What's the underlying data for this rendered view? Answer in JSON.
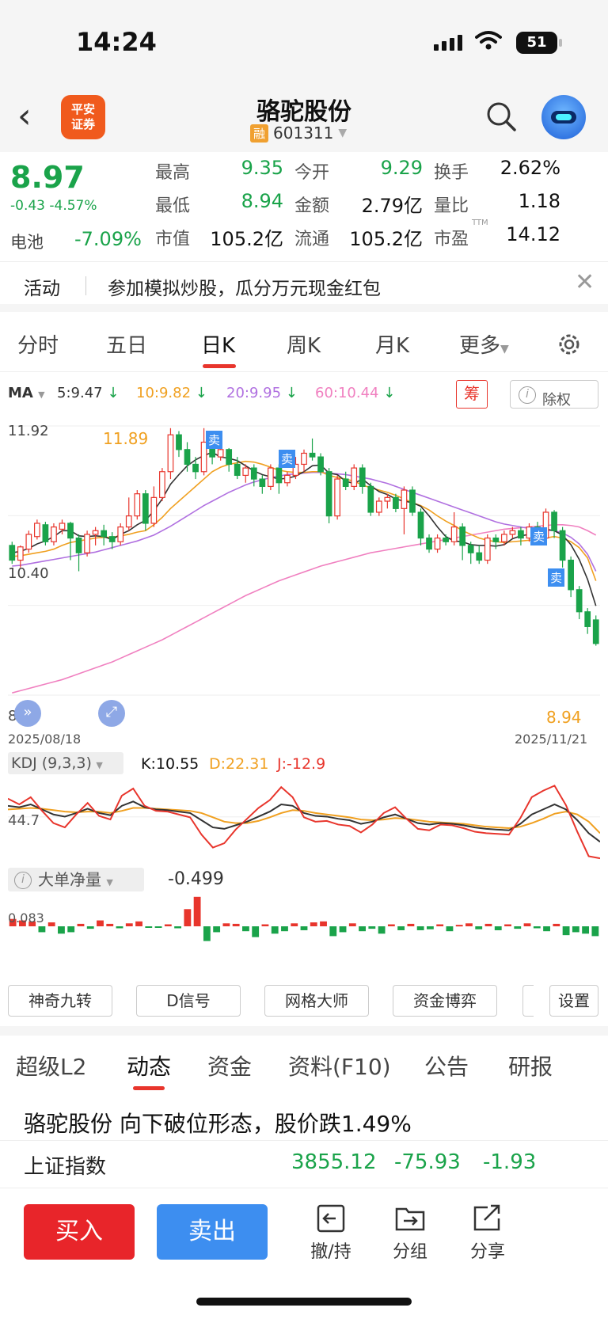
{
  "status": {
    "time": "14:24",
    "battery": "51"
  },
  "header": {
    "logo_top": "平安",
    "logo_bottom": "证券",
    "name": "骆驼股份",
    "tag": "融",
    "code": "601311"
  },
  "quote": {
    "price": "8.97",
    "change": "-0.43 -4.57%",
    "sector": "电池",
    "sector_change": "-7.09%",
    "fields": [
      {
        "label": "最高",
        "value": "9.35"
      },
      {
        "label": "今开",
        "value": "9.29"
      },
      {
        "label": "换手",
        "value": "2.62%"
      },
      {
        "label": "最低",
        "value": "8.94"
      },
      {
        "label": "金额",
        "value": "2.79亿"
      },
      {
        "label": "量比",
        "value": "1.18"
      },
      {
        "label": "市值",
        "value": "105.2亿"
      },
      {
        "label": "流通",
        "value": "105.2亿"
      },
      {
        "label": "市盈",
        "value": "14.12",
        "sup": "TTM"
      }
    ]
  },
  "banner": {
    "tag": "活动",
    "text": "参加模拟炒股，瓜分万元现金红包"
  },
  "chart_tabs": [
    "分时",
    "五日",
    "日K",
    "周K",
    "月K",
    "更多"
  ],
  "active_chart_tab": "日K",
  "ma": {
    "label": "MA",
    "items": [
      {
        "text": "5:9.47",
        "color": "#333333"
      },
      {
        "text": "10:9.82",
        "color": "#f0a020"
      },
      {
        "text": "20:9.95",
        "color": "#b070e0"
      },
      {
        "text": "60:10.44",
        "color": "#f080c0"
      }
    ],
    "chip_btn": "筹",
    "fq_btn": "除权"
  },
  "chart_data": {
    "type": "candlestick",
    "y_max_label": "11.92",
    "y_mid_label": "10.40",
    "y_min_label": "8.27",
    "high_mark": "11.89",
    "low_mark": "8.94",
    "x_start": "2025/08/18",
    "x_end": "2025/11/21",
    "sell_marker": "卖",
    "candles": [
      [
        10.3,
        10.1,
        10.35,
        10.05
      ],
      [
        10.1,
        10.28,
        10.3,
        10.0
      ],
      [
        10.25,
        10.45,
        10.5,
        10.2
      ],
      [
        10.42,
        10.6,
        10.65,
        10.38
      ],
      [
        10.58,
        10.35,
        10.62,
        10.3
      ],
      [
        10.35,
        10.55,
        10.6,
        10.3
      ],
      [
        10.52,
        10.6,
        10.65,
        10.45
      ],
      [
        10.6,
        10.4,
        10.62,
        10.1
      ],
      [
        10.4,
        10.2,
        10.45,
        9.95
      ],
      [
        10.2,
        10.45,
        10.5,
        10.15
      ],
      [
        10.45,
        10.5,
        10.55,
        10.3
      ],
      [
        10.5,
        10.42,
        10.58,
        10.3
      ],
      [
        10.42,
        10.35,
        10.48,
        10.25
      ],
      [
        10.35,
        10.55,
        10.6,
        10.3
      ],
      [
        10.55,
        10.7,
        10.95,
        10.5
      ],
      [
        10.7,
        11.0,
        11.05,
        10.65
      ],
      [
        11.0,
        10.6,
        11.05,
        10.5
      ],
      [
        10.6,
        10.95,
        11.1,
        10.55
      ],
      [
        10.95,
        11.3,
        11.35,
        10.9
      ],
      [
        11.3,
        11.8,
        11.89,
        11.2
      ],
      [
        11.8,
        11.6,
        11.85,
        11.5
      ],
      [
        11.6,
        11.4,
        11.7,
        11.3
      ],
      [
        11.4,
        11.3,
        11.5,
        11.2
      ],
      [
        11.3,
        11.7,
        11.89,
        11.25
      ],
      [
        11.7,
        11.5,
        11.75,
        11.4
      ],
      [
        11.5,
        11.6,
        11.65,
        11.45
      ],
      [
        11.6,
        11.4,
        11.62,
        11.3
      ],
      [
        11.4,
        11.25,
        11.5,
        11.2
      ],
      [
        11.25,
        11.35,
        11.4,
        11.15
      ],
      [
        11.35,
        11.2,
        11.4,
        11.1
      ],
      [
        11.2,
        11.1,
        11.25,
        11.0
      ],
      [
        11.1,
        11.35,
        11.4,
        11.05
      ],
      [
        11.35,
        11.15,
        11.4,
        11.0
      ],
      [
        11.15,
        11.25,
        11.3,
        11.1
      ],
      [
        11.25,
        11.4,
        11.5,
        11.2
      ],
      [
        11.4,
        11.55,
        11.6,
        11.3
      ],
      [
        11.55,
        11.5,
        11.75,
        11.45
      ],
      [
        11.5,
        11.3,
        11.55,
        11.25
      ],
      [
        11.3,
        10.7,
        11.35,
        10.6
      ],
      [
        10.7,
        11.2,
        11.25,
        10.65
      ],
      [
        11.2,
        11.1,
        11.3,
        11.05
      ],
      [
        11.1,
        11.35,
        11.4,
        11.05
      ],
      [
        11.35,
        11.1,
        11.4,
        11.0
      ],
      [
        11.1,
        10.75,
        11.15,
        10.7
      ],
      [
        10.75,
        10.9,
        10.95,
        10.7
      ],
      [
        10.9,
        10.95,
        11.0,
        10.8
      ],
      [
        10.95,
        10.8,
        11.0,
        10.75
      ],
      [
        10.8,
        11.05,
        11.1,
        10.45
      ],
      [
        11.05,
        10.75,
        11.1,
        10.7
      ],
      [
        10.75,
        10.4,
        10.8,
        10.3
      ],
      [
        10.4,
        10.25,
        10.45,
        10.2
      ],
      [
        10.25,
        10.4,
        10.45,
        10.2
      ],
      [
        10.4,
        10.35,
        10.45,
        10.3
      ],
      [
        10.35,
        10.55,
        10.75,
        10.3
      ],
      [
        10.55,
        10.3,
        10.6,
        10.1
      ],
      [
        10.3,
        10.2,
        10.35,
        10.05
      ],
      [
        10.2,
        10.1,
        10.3,
        10.05
      ],
      [
        10.1,
        10.4,
        10.45,
        10.05
      ],
      [
        10.4,
        10.35,
        10.45,
        10.25
      ],
      [
        10.35,
        10.45,
        10.5,
        10.3
      ],
      [
        10.45,
        10.5,
        10.55,
        10.4
      ],
      [
        10.5,
        10.4,
        10.55,
        10.3
      ],
      [
        10.4,
        10.55,
        10.6,
        10.35
      ],
      [
        10.55,
        10.4,
        10.62,
        10.35
      ],
      [
        10.4,
        10.75,
        10.8,
        10.35
      ],
      [
        10.75,
        10.5,
        10.78,
        10.4
      ],
      [
        10.5,
        10.1,
        10.55,
        10.0
      ],
      [
        10.1,
        9.7,
        10.15,
        9.6
      ],
      [
        9.7,
        9.4,
        9.75,
        9.3
      ],
      [
        9.4,
        9.2,
        9.45,
        9.1
      ],
      [
        9.29,
        8.97,
        9.35,
        8.94
      ]
    ],
    "ma5": [
      10.2,
      10.22,
      10.26,
      10.32,
      10.36,
      10.42,
      10.5,
      10.5,
      10.43,
      10.42,
      10.43,
      10.42,
      10.38,
      10.45,
      10.5,
      10.58,
      10.64,
      10.77,
      10.93,
      11.13,
      11.26,
      11.38,
      11.46,
      11.52,
      11.56,
      11.5,
      11.48,
      11.45,
      11.38,
      11.31,
      11.26,
      11.23,
      11.2,
      11.21,
      11.24,
      11.3,
      11.38,
      11.39,
      11.28,
      11.26,
      11.17,
      11.14,
      11.2,
      11.11,
      11.03,
      10.99,
      10.93,
      10.9,
      10.88,
      10.83,
      10.7,
      10.55,
      10.42,
      10.36,
      10.35,
      10.31,
      10.3,
      10.3,
      10.29,
      10.31,
      10.39,
      10.43,
      10.45,
      10.47,
      10.52,
      10.5,
      10.44,
      10.31,
      10.11,
      9.84,
      9.48
    ],
    "ma10": [
      10.15,
      10.16,
      10.18,
      10.2,
      10.22,
      10.25,
      10.3,
      10.34,
      10.36,
      10.38,
      10.4,
      10.41,
      10.41,
      10.43,
      10.45,
      10.48,
      10.5,
      10.58,
      10.68,
      10.8,
      10.9,
      11.0,
      11.1,
      11.2,
      11.3,
      11.36,
      11.4,
      11.42,
      11.44,
      11.43,
      11.4,
      11.36,
      11.32,
      11.3,
      11.29,
      11.29,
      11.3,
      11.3,
      11.25,
      11.22,
      11.2,
      11.17,
      11.12,
      11.08,
      11.05,
      11.02,
      10.98,
      10.93,
      10.88,
      10.84,
      10.78,
      10.7,
      10.63,
      10.57,
      10.5,
      10.45,
      10.4,
      10.37,
      10.35,
      10.34,
      10.35,
      10.36,
      10.37,
      10.38,
      10.4,
      10.42,
      10.4,
      10.35,
      10.27,
      10.13,
      9.82
    ],
    "ma20": [
      10.02,
      10.03,
      10.05,
      10.07,
      10.09,
      10.11,
      10.13,
      10.15,
      10.17,
      10.19,
      10.21,
      10.24,
      10.27,
      10.3,
      10.33,
      10.36,
      10.4,
      10.44,
      10.5,
      10.56,
      10.63,
      10.7,
      10.77,
      10.84,
      10.9,
      10.96,
      11.02,
      11.07,
      11.12,
      11.16,
      11.19,
      11.22,
      11.24,
      11.26,
      11.27,
      11.28,
      11.29,
      11.29,
      11.28,
      11.27,
      11.26,
      11.24,
      11.22,
      11.2,
      11.17,
      11.14,
      11.1,
      11.06,
      11.02,
      10.98,
      10.94,
      10.9,
      10.86,
      10.82,
      10.78,
      10.74,
      10.7,
      10.66,
      10.62,
      10.59,
      10.57,
      10.55,
      10.53,
      10.52,
      10.51,
      10.5,
      10.47,
      10.41,
      10.32,
      10.18,
      9.95
    ],
    "ma60": [
      8.3,
      8.33,
      8.36,
      8.39,
      8.42,
      8.45,
      8.48,
      8.52,
      8.56,
      8.6,
      8.64,
      8.68,
      8.72,
      8.77,
      8.82,
      8.87,
      8.92,
      8.97,
      9.02,
      9.08,
      9.14,
      9.2,
      9.26,
      9.32,
      9.38,
      9.44,
      9.5,
      9.56,
      9.62,
      9.67,
      9.72,
      9.77,
      9.82,
      9.86,
      9.9,
      9.94,
      9.98,
      10.02,
      10.05,
      10.08,
      10.11,
      10.14,
      10.17,
      10.2,
      10.22,
      10.24,
      10.26,
      10.28,
      10.3,
      10.32,
      10.34,
      10.36,
      10.38,
      10.4,
      10.42,
      10.44,
      10.46,
      10.48,
      10.5,
      10.52,
      10.53,
      10.54,
      10.55,
      10.56,
      10.57,
      10.58,
      10.58,
      10.57,
      10.55,
      10.5,
      10.44
    ]
  },
  "kdj": {
    "label": "KDJ (9,3,3)",
    "k": "K:10.55",
    "d": "D:22.31",
    "j": "J:-12.9",
    "mid": "44.7",
    "k_line": [
      60,
      58,
      62,
      55,
      48,
      45,
      50,
      56,
      50,
      47,
      60,
      66,
      58,
      55,
      54,
      52,
      50,
      40,
      30,
      28,
      33,
      38,
      45,
      52,
      62,
      60,
      50,
      46,
      45,
      42,
      40,
      35,
      38,
      44,
      48,
      42,
      36,
      34,
      36,
      35,
      33,
      30,
      28,
      27,
      26,
      35,
      48,
      55,
      62,
      55,
      40,
      22,
      10
    ],
    "d_line": [
      55,
      56,
      57,
      56,
      54,
      52,
      51,
      52,
      52,
      50,
      53,
      57,
      57,
      56,
      55,
      54,
      53,
      50,
      44,
      38,
      36,
      36,
      39,
      44,
      50,
      54,
      53,
      50,
      48,
      46,
      44,
      41,
      40,
      41,
      43,
      42,
      40,
      38,
      37,
      36,
      35,
      33,
      31,
      30,
      29,
      31,
      36,
      42,
      49,
      52,
      48,
      38,
      22
    ],
    "j_line": [
      70,
      62,
      72,
      53,
      36,
      30,
      48,
      64,
      46,
      41,
      74,
      84,
      60,
      53,
      52,
      48,
      44,
      20,
      2,
      8,
      27,
      42,
      57,
      68,
      86,
      72,
      44,
      38,
      39,
      34,
      32,
      23,
      34,
      50,
      58,
      42,
      28,
      26,
      34,
      33,
      29,
      24,
      22,
      21,
      20,
      43,
      72,
      81,
      88,
      61,
      24,
      -10,
      -13
    ]
  },
  "dadan": {
    "label": "大单净量",
    "value": "-0.499",
    "axis": "0.083",
    "bars": [
      0.15,
      0.12,
      0.1,
      -0.12,
      0.08,
      -0.15,
      -0.12,
      0.05,
      -0.05,
      0.12,
      0.05,
      -0.04,
      0.06,
      0.1,
      -0.02,
      -0.03,
      0.04,
      -0.04,
      0.35,
      0.6,
      -0.3,
      -0.12,
      0.06,
      0.05,
      -0.1,
      -0.22,
      0.04,
      -0.15,
      -0.1,
      0.06,
      -0.08,
      0.08,
      0.1,
      -0.2,
      -0.12,
      0.06,
      -0.1,
      -0.05,
      -0.15,
      0.04,
      -0.08,
      0.05,
      -0.08,
      -0.06,
      0.04,
      -0.1,
      0.03,
      0.06,
      -0.06,
      0.05,
      -0.08,
      0.04,
      -0.05,
      0.06,
      -0.04,
      -0.1,
      0.05,
      -0.18,
      -0.12,
      -0.15,
      -0.2
    ]
  },
  "tool_buttons": [
    "神奇九转",
    "D信号",
    "网格大师",
    "资金博弈",
    "设置"
  ],
  "feature_tabs": [
    "超级L2",
    "动态",
    "资金",
    "资料(F10)",
    "公告",
    "研报"
  ],
  "active_feature_tab": "动态",
  "news_headline": "骆驼股份 向下破位形态，股价跌1.49%",
  "index": {
    "name": "上证指数",
    "value": "3855.12",
    "change": "-75.93",
    "pct": "-1.93"
  },
  "bottom": {
    "buy": "买入",
    "sell": "卖出",
    "actions": [
      {
        "label": "撤/持",
        "icon": "cancel-hold-icon"
      },
      {
        "label": "分组",
        "icon": "group-icon"
      },
      {
        "label": "分享",
        "icon": "share-icon"
      }
    ]
  },
  "colors": {
    "up": "#e8352c",
    "down": "#1aa34a",
    "accent": "#e8352c",
    "sell_blue": "#3d8ef0"
  }
}
